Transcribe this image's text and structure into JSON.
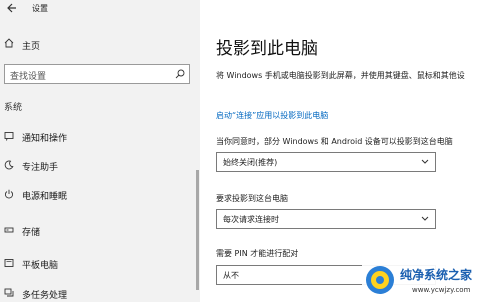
{
  "app": {
    "title": "设置"
  },
  "sidebar": {
    "home": "主页",
    "search_placeholder": "查找设置",
    "section": "系统",
    "items": [
      {
        "label": "通知和操作",
        "icon": "notification-icon"
      },
      {
        "label": "专注助手",
        "icon": "moon-icon"
      },
      {
        "label": "电源和睡眠",
        "icon": "power-icon"
      },
      {
        "label": "存储",
        "icon": "storage-icon"
      },
      {
        "label": "平板电脑",
        "icon": "tablet-icon"
      },
      {
        "label": "多任务处理",
        "icon": "multitask-icon"
      }
    ]
  },
  "main": {
    "title": "投影到此电脑",
    "description": "将 Windows 手机或电脑投影到此屏幕，并使用其键盘、鼠标和其他设",
    "link": "启动“连接”应用以投影到此电脑",
    "setting1": {
      "label": "当你同意时，部分 Windows 和 Android 设备可以投影到这台电脑",
      "value": "始终关闭(推荐)"
    },
    "setting2": {
      "label": "要求投影到这台电脑",
      "value": "每次请求连接时"
    },
    "setting3": {
      "label": "需要 PIN 才能进行配对",
      "value": "从不"
    }
  },
  "watermark": {
    "text": "纯净系统之家",
    "url": "www.ycwjzy.com"
  },
  "colors": {
    "accent": "#0067c0",
    "sidebar_bg": "#f2f2f2"
  }
}
